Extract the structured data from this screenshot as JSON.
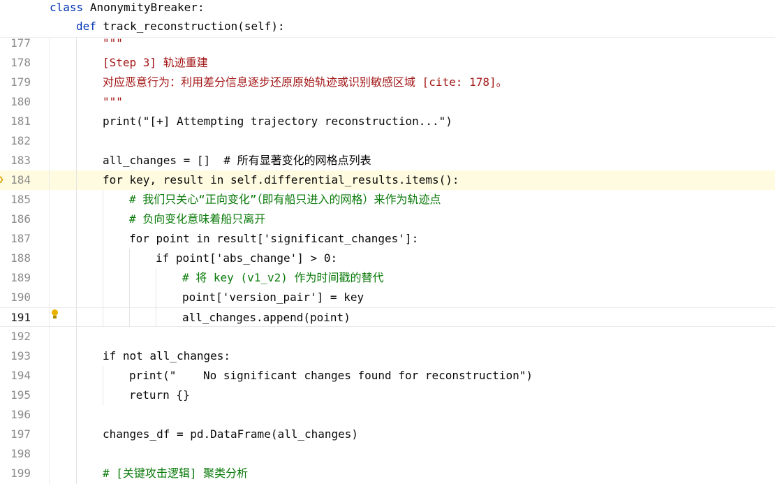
{
  "breadcrumb": {
    "class_kw": "class",
    "class_name": "AnonymityBreaker:",
    "def_kw": "def",
    "func_sig": "track_reconstruction(self):"
  },
  "lines": [
    {
      "n": "177",
      "t": "\"\"\""
    },
    {
      "n": "178",
      "t": "[Step 3] 轨迹重建"
    },
    {
      "n": "179",
      "t": "对应恶意行为：利用差分信息逐步还原原始轨迹或识别敏感区域 [cite: 178]。"
    },
    {
      "n": "180",
      "t": "\"\"\""
    },
    {
      "n": "181",
      "t": "print(\"[+] Attempting trajectory reconstruction...\")"
    },
    {
      "n": "182",
      "t": ""
    },
    {
      "n": "183",
      "t": "all_changes = []  # 所有显著变化的网格点列表"
    },
    {
      "n": "184",
      "t": "for key, result in self.differential_results.items():"
    },
    {
      "n": "185",
      "t": "# 我们只关心“正向变化”（即有船只进入的网格）来作为轨迹点"
    },
    {
      "n": "186",
      "t": "# 负向变化意味着船只离开"
    },
    {
      "n": "187",
      "t": "for point in result['significant_changes']:"
    },
    {
      "n": "188",
      "t": "if point['abs_change'] > 0:"
    },
    {
      "n": "189",
      "t": "# 将 key (v1_v2) 作为时间戳的替代"
    },
    {
      "n": "190",
      "t": "point['version_pair'] = key"
    },
    {
      "n": "191",
      "t": "all_changes.append(point)"
    },
    {
      "n": "192",
      "t": ""
    },
    {
      "n": "193",
      "t": "if not all_changes:"
    },
    {
      "n": "194",
      "t": "print(\"    No significant changes found for reconstruction\")"
    },
    {
      "n": "195",
      "t": "return {}"
    },
    {
      "n": "196",
      "t": ""
    },
    {
      "n": "197",
      "t": "changes_df = pd.DataFrame(all_changes)"
    },
    {
      "n": "198",
      "t": ""
    },
    {
      "n": "199",
      "t": "# [关键攻击逻辑] 聚类分析"
    }
  ],
  "colors": {
    "keyword": "#0033b3",
    "string": "#067d17",
    "comment": "#8c8c8c",
    "docstring": "#a31515",
    "number": "#1750eb",
    "self": "#94558d",
    "current_line_bg": "#fffbe0",
    "line_number": "#8c8c8c"
  },
  "icons": {
    "breakpoint_line": "184",
    "intention_bulb_line": "191"
  }
}
